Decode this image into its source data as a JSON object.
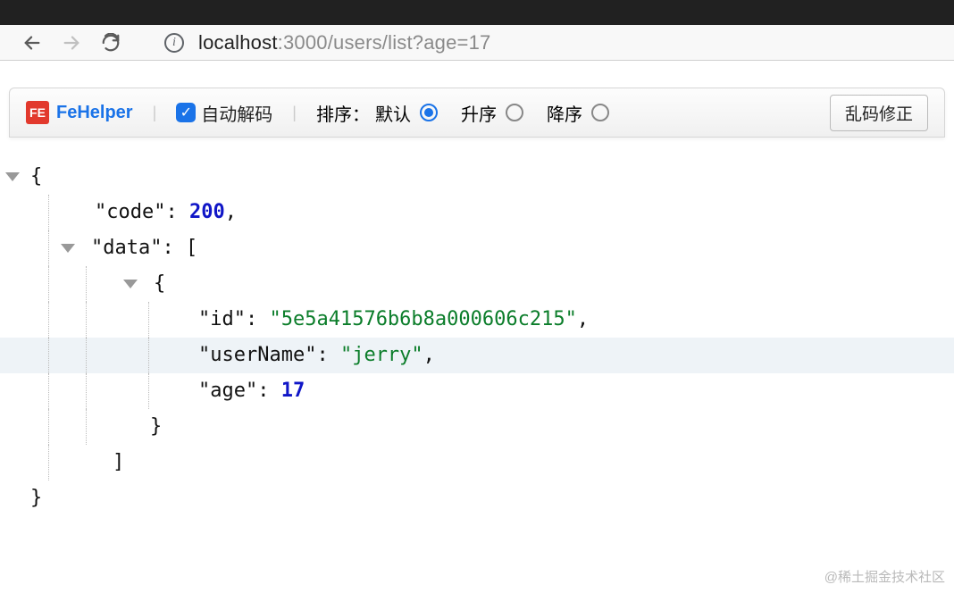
{
  "browser": {
    "url_host": "localhost",
    "url_port": ":3000",
    "url_path": "/users/list?age=17"
  },
  "extension": {
    "logo_text": "FE",
    "name": "FeHelper",
    "auto_decode_label": "自动解码",
    "auto_decode_checked": true,
    "sort_label": "排序：",
    "sort_options": {
      "default": "默认",
      "asc": "升序",
      "desc": "降序"
    },
    "sort_selected": "default",
    "fix_button_label": "乱码修正"
  },
  "json": {
    "code_key": "\"code\"",
    "code_val": "200",
    "data_key": "\"data\"",
    "id_key": "\"id\"",
    "id_val": "\"5e5a41576b6b8a000606c215\"",
    "userName_key": "\"userName\"",
    "userName_val": "\"jerry\"",
    "age_key": "\"age\"",
    "age_val": "17"
  },
  "watermark": "@稀土掘金技术社区"
}
